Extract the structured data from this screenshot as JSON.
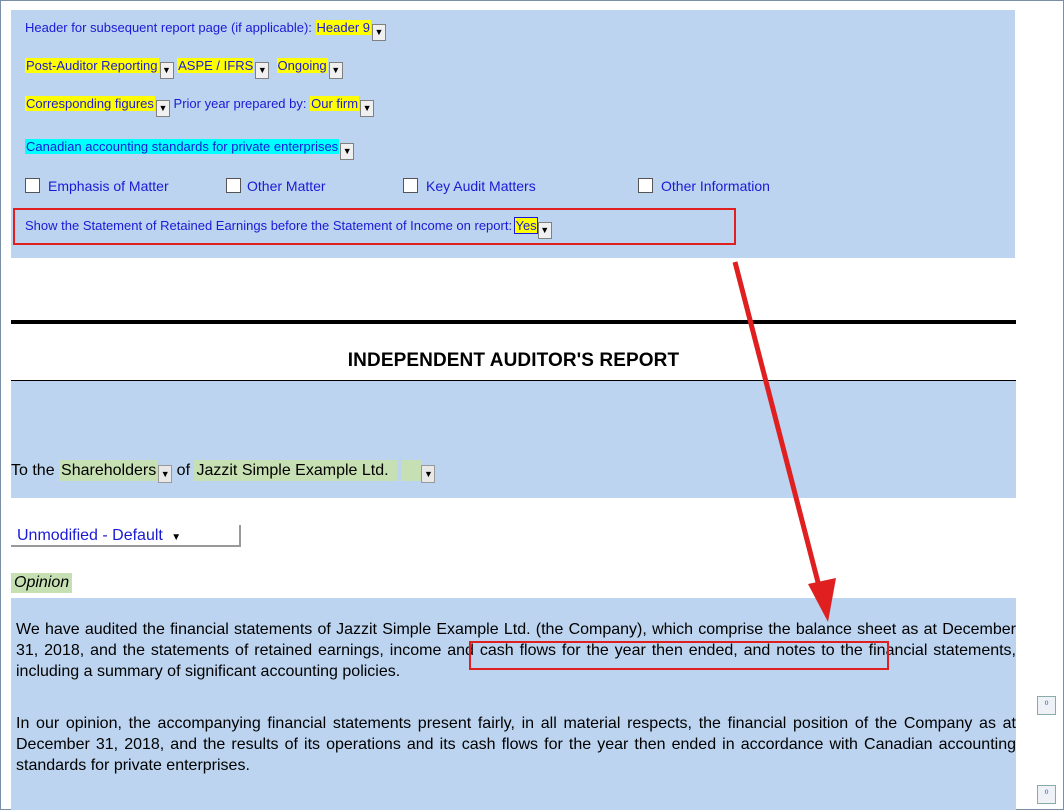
{
  "form": {
    "header_label": "Header for subsequent report page (if applicable):",
    "header_value": "Header 9",
    "reporting_value": "Post-Auditor Reporting",
    "standards_value": "ASPE / IFRS",
    "engagement_value": "Ongoing",
    "figures_value": "Corresponding figures",
    "prior_year_label": "Prior year prepared by:",
    "prior_year_value": "Our firm",
    "framework_value": "Canadian accounting standards for private enterprises",
    "checkboxes": [
      {
        "label": "Emphasis of Matter",
        "checked": false
      },
      {
        "label": "Other Matter",
        "checked": false
      },
      {
        "label": "Key Audit Matters",
        "checked": false
      },
      {
        "label": "Other Information",
        "checked": false
      }
    ],
    "retained_label": "Show the Statement of Retained Earnings before the Statement of Income on report:",
    "retained_value": "Yes"
  },
  "report": {
    "title": "INDEPENDENT AUDITOR'S REPORT",
    "to_the": "To the",
    "addressee": "Shareholders",
    "of": "of",
    "company": "Jazzit Simple Example Ltd.",
    "opinion_type": "Unmodified - Default",
    "opinion_heading": "Opinion",
    "para1_pre": "We have audited the financial statements of Jazzit Simple Example Ltd. (the Company), which comprise the balance sheet as at December 31, 2018, and ",
    "para1_highlight": "the statements of retained earnings, income",
    "para1_post": " and cash flows for the year then ended, and notes to the financial statements, including a summary of significant accounting policies.",
    "para2": "In our opinion, the accompanying financial statements present fairly, in all material respects, the financial position of the Company as at December 31, 2018, and the results of its operations and its cash flows for the year then ended in accordance with Canadian accounting standards for private enterprises."
  },
  "icons": {
    "dropdown": "chevron-down-icon",
    "info": "info-icon",
    "annotation": "red-arrow"
  },
  "colors": {
    "panel": "#bcd4ef",
    "highlight_yellow": "#ffff00",
    "highlight_cyan": "#00ffff",
    "field_green": "#c6e0b4",
    "annotation_red": "#e02020",
    "link_blue": "#1a1ad6"
  }
}
